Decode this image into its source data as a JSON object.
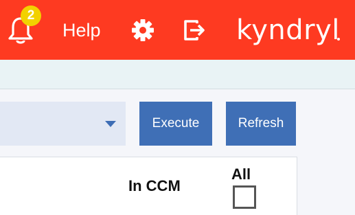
{
  "header": {
    "notification_count": "2",
    "help_label": "Help",
    "brand_name": "kyndryl",
    "bg_color": "#fe3a21",
    "badge_color": "#f2d100",
    "icons": [
      "bell-icon",
      "gear-icon",
      "logout-icon"
    ]
  },
  "toolbar": {
    "dropdown_value": "",
    "execute_label": "Execute",
    "refresh_label": "Refresh",
    "button_color": "#3f6fb6"
  },
  "table": {
    "headers": {
      "in_ccm": "In CCM",
      "all": "All"
    },
    "select_all_checked": false
  }
}
